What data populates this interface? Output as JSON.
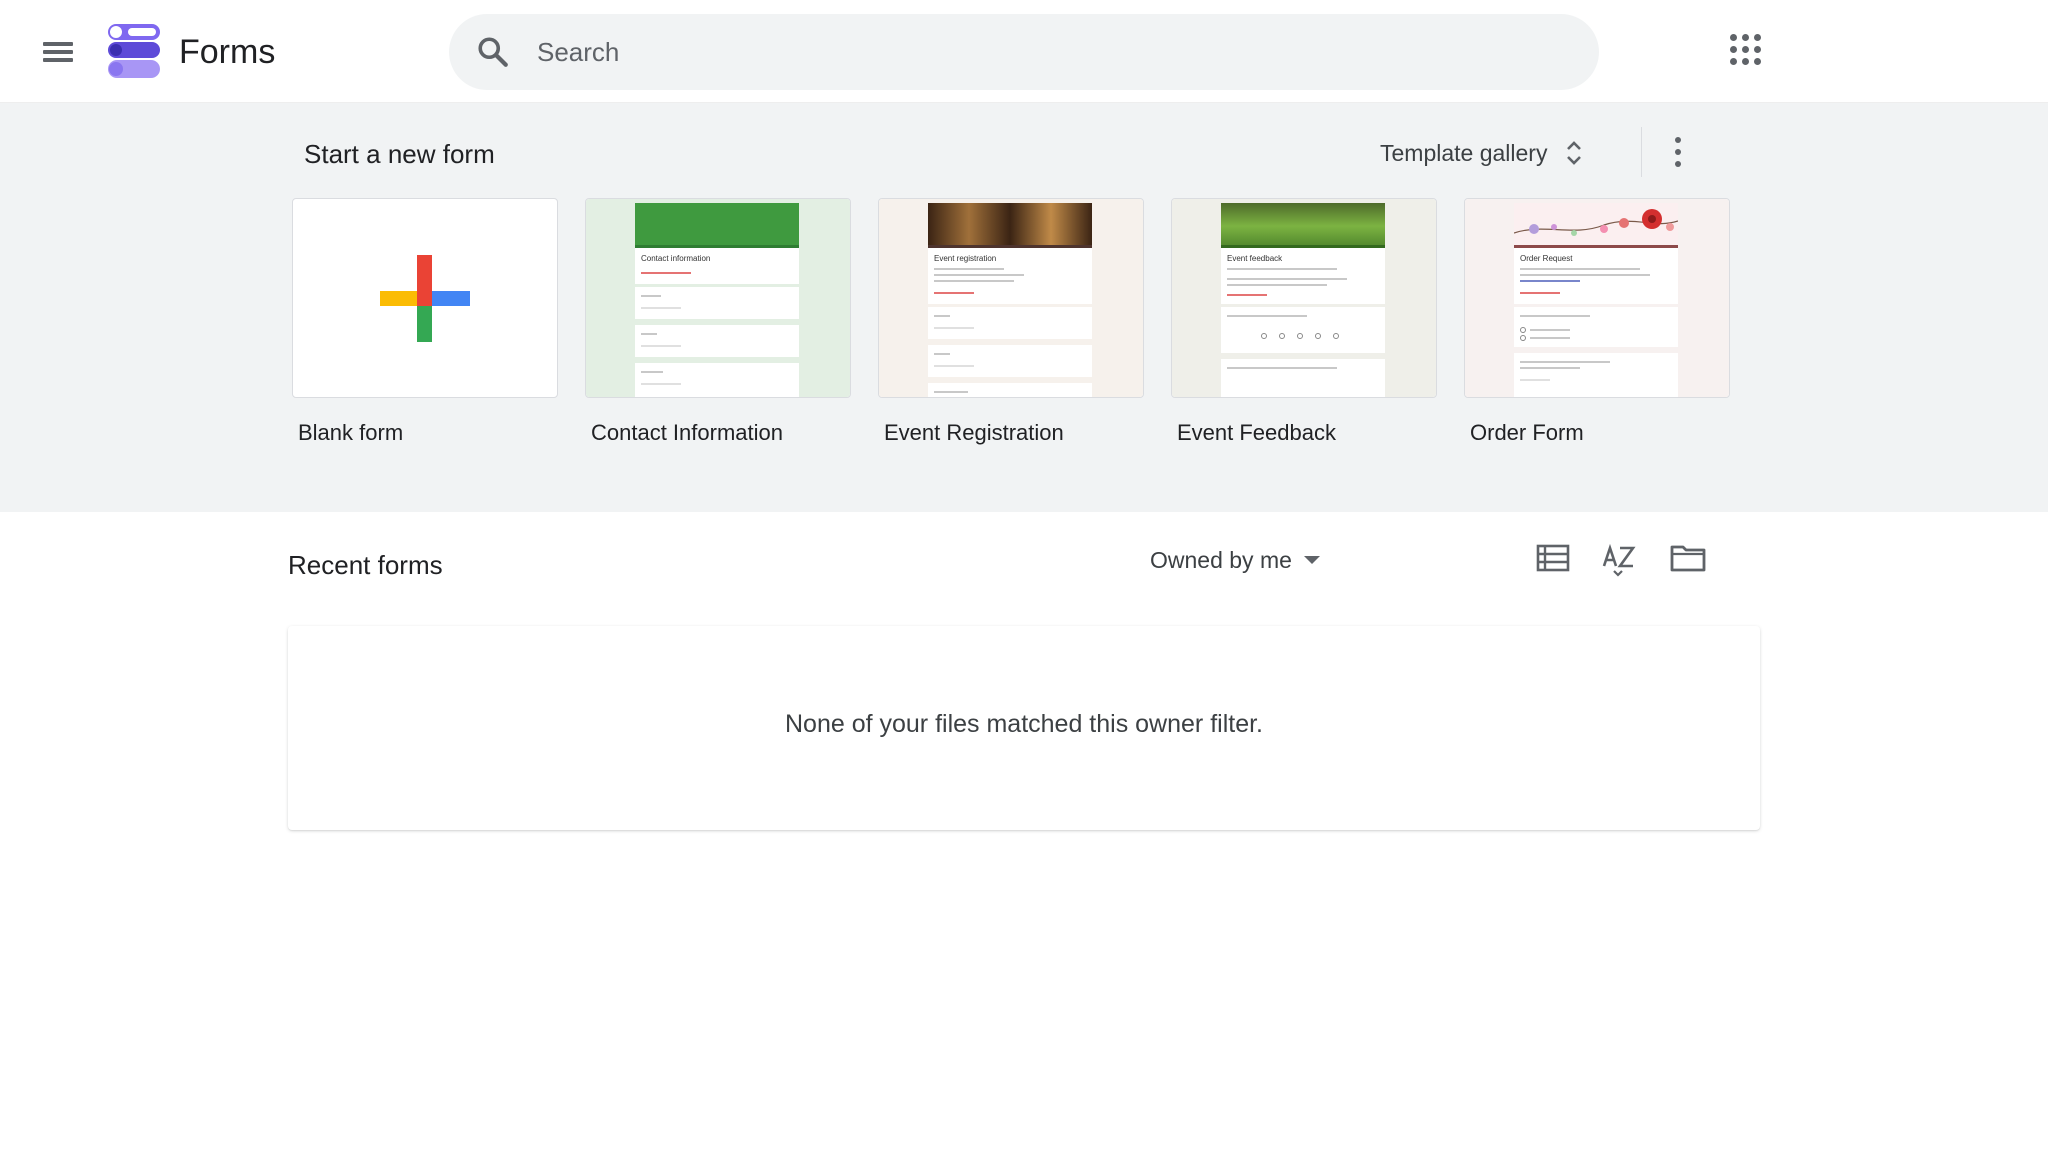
{
  "header": {
    "app_name": "Forms",
    "search": {
      "placeholder": "Search",
      "value": ""
    },
    "icons": [
      "menu-icon",
      "forms-logo",
      "search-icon",
      "apps-icon"
    ]
  },
  "templates": {
    "section_title": "Start a new form",
    "gallery_label": "Template gallery",
    "items": [
      {
        "label": "Blank form",
        "preview_title": ""
      },
      {
        "label": "Contact Information",
        "preview_title": "Contact information"
      },
      {
        "label": "Event Registration",
        "preview_title": "Event registration"
      },
      {
        "label": "Event Feedback",
        "preview_title": "Event feedback"
      },
      {
        "label": "Order Form",
        "preview_title": "Order Request"
      }
    ]
  },
  "recent": {
    "title": "Recent forms",
    "owner_filter": "Owned by me",
    "empty_message": "None of your files matched this owner filter.",
    "tools": [
      "list-view-icon",
      "sort-az-icon",
      "folder-icon"
    ]
  },
  "colors": {
    "accent": "#673ab7",
    "template_bg": "#f1f3f4",
    "contact_green": "#43a047",
    "event_dark": "#5d3b1f",
    "feedback_green": "#7cb342",
    "order_rose": "#d32f2f"
  }
}
